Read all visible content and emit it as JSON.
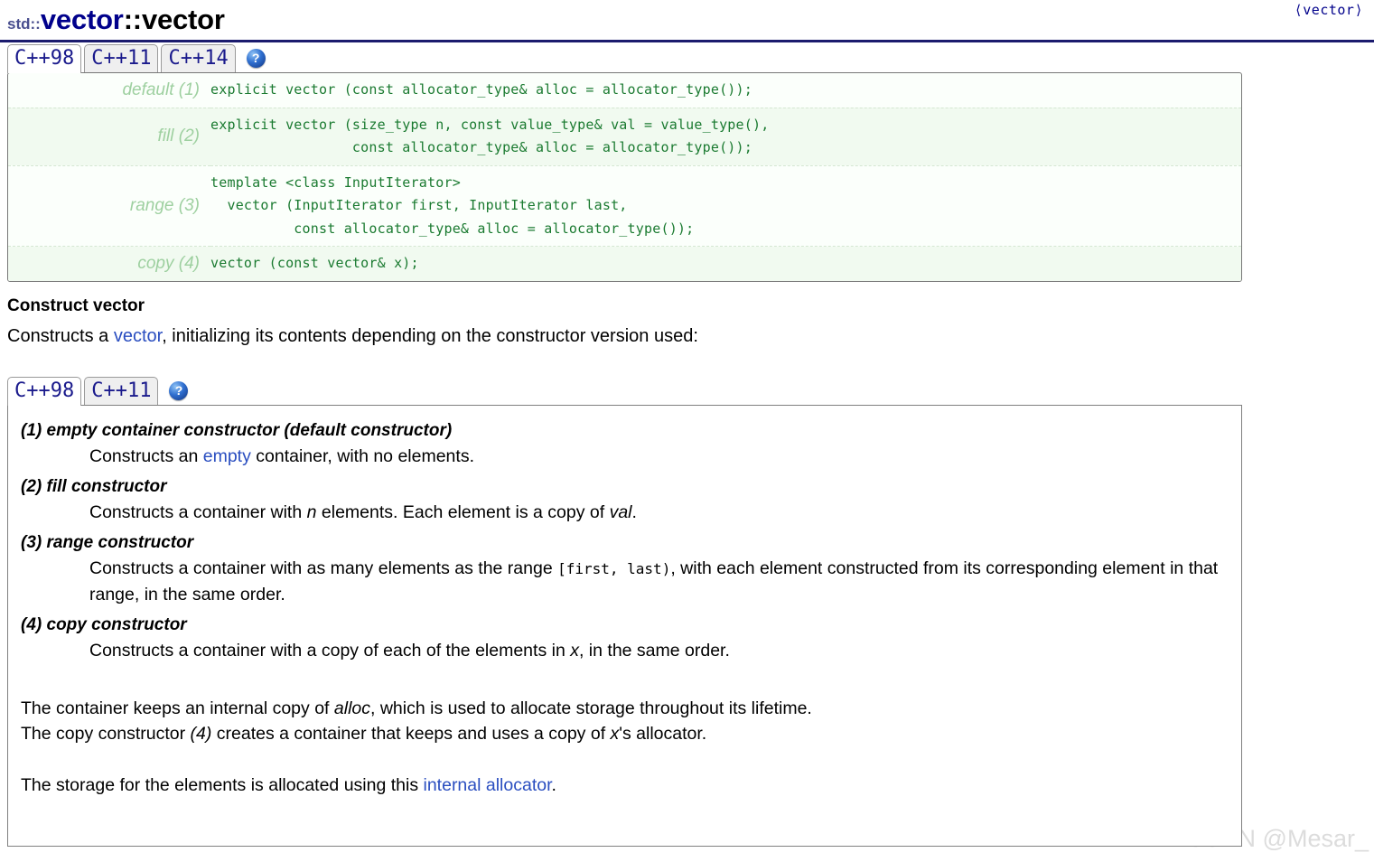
{
  "header": {
    "namespace": "std::",
    "class_name": "vector",
    "separator": "::",
    "member_name": "vector",
    "include_header": "⟨vector⟩"
  },
  "signature_tabs": {
    "items": [
      {
        "label": "C++98",
        "active": true
      },
      {
        "label": "C++11",
        "active": false
      },
      {
        "label": "C++14",
        "active": false
      }
    ],
    "help_glyph": "?"
  },
  "signatures": [
    {
      "label": "default (1)",
      "code": "explicit vector (const allocator_type& alloc = allocator_type());"
    },
    {
      "label": "fill (2)",
      "code": "explicit vector (size_type n, const value_type& val = value_type(),\n                 const allocator_type& alloc = allocator_type());"
    },
    {
      "label": "range (3)",
      "code": "template <class InputIterator>\n  vector (InputIterator first, InputIterator last,\n          const allocator_type& alloc = allocator_type());"
    },
    {
      "label": "copy (4)",
      "code": "vector (const vector& x);"
    }
  ],
  "section": {
    "title": "Construct vector",
    "lead_before": "Constructs a ",
    "lead_link": "vector",
    "lead_after": ", initializing its contents depending on the constructor version used:"
  },
  "description_tabs": {
    "items": [
      {
        "label": "C++98",
        "active": true
      },
      {
        "label": "C++11",
        "active": false
      }
    ],
    "help_glyph": "?"
  },
  "constructors": [
    {
      "heading": "(1) empty container constructor (default constructor)",
      "body_1": "Constructs an ",
      "body_link": "empty",
      "body_2": " container, with no elements."
    },
    {
      "heading": "(2) fill constructor",
      "body_1": "Constructs a container with ",
      "body_em": "n",
      "body_2": " elements. Each element is a copy of ",
      "body_em2": "val",
      "body_3": "."
    },
    {
      "heading": "(3) range constructor",
      "body_1": "Constructs a container with as many elements as the range ",
      "body_mono": "[first, last)",
      "body_2": ", with each element constructed from its corresponding element in that range, in the same order."
    },
    {
      "heading": "(4) copy constructor",
      "body_1": "Constructs a container with a copy of each of the elements in ",
      "body_em": "x",
      "body_2": ", in the same order."
    }
  ],
  "notes": {
    "p1_a": "The container keeps an internal copy of ",
    "p1_em": "alloc",
    "p1_b": ", which is used to allocate storage throughout its lifetime.",
    "p2_a": "The copy constructor ",
    "p2_em": "(4)",
    "p2_b": " creates a container that keeps and uses a copy of ",
    "p2_em2": "x",
    "p2_c": "'s allocator.",
    "p3_a": "The storage for the elements is allocated using this ",
    "p3_link": "internal allocator",
    "p3_b": "."
  },
  "watermark": "CSDN @Mesar_",
  "colors": {
    "title_class": "#00008b",
    "namespace": "#4a4f8f",
    "link": "#2a4ec0",
    "code_text": "#1a7a30",
    "code_label": "#9ed0a0",
    "code_bg": "#fbfffb",
    "code_bg_alt": "#f1faf0",
    "tab_text": "#1a1a8c",
    "rule": "#1b1b6e",
    "watermark": "#dcdcdc"
  }
}
